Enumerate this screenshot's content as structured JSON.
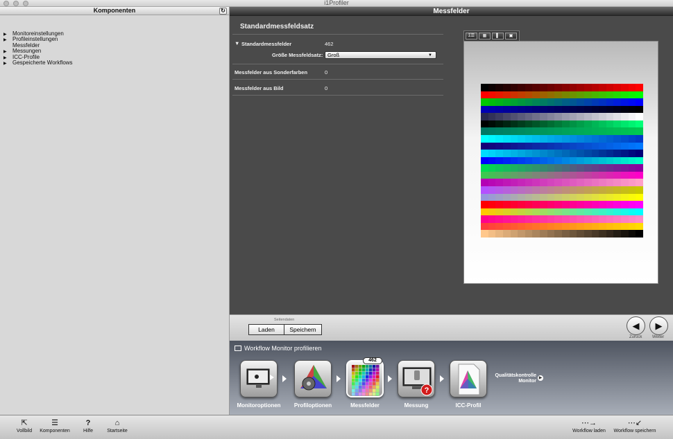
{
  "window": {
    "title": "i1Profiler"
  },
  "left_panel": {
    "header": "Komponenten",
    "refresh_icon": "refresh-icon",
    "items": [
      {
        "label": "Monitoreinstellungen",
        "expanded": false
      },
      {
        "label": "Profileinstellungen",
        "expanded": false
      },
      {
        "label": "Messfelder",
        "expanded": null
      },
      {
        "label": "Messungen",
        "expanded": false
      },
      {
        "label": "ICC-Profile",
        "expanded": false
      },
      {
        "label": "Gespeicherte Workflows",
        "expanded": false
      }
    ]
  },
  "main": {
    "header": "Messfelder",
    "section_title": "Standardmessfeldsatz",
    "rows": {
      "standard": {
        "label": "Standardmessfelder",
        "value": "462"
      },
      "size": {
        "label": "Größe Messfeldsatz:",
        "value": "Groß"
      },
      "spot": {
        "label": "Messfelder aus Sonderfarben",
        "value": "0"
      },
      "image": {
        "label": "Messfelder aus Bild",
        "value": "0"
      }
    },
    "preview_toolbar": [
      "sigma-grid-icon",
      "grid-icon",
      "single-patch-icon",
      "image-icon"
    ],
    "patch_grid": {
      "columns": 22,
      "rows": 21
    }
  },
  "nav": {
    "group_label": "Seitendaten",
    "load": "Laden",
    "save": "Speichern",
    "back": "Zurück",
    "next": "Weiter"
  },
  "workflow": {
    "title": "Workflow Monitor profilieren",
    "badge": "462",
    "steps": [
      {
        "label": "Monitoroptionen",
        "icon": "monitor-options-icon"
      },
      {
        "label": "Profiloptionen",
        "icon": "profile-options-icon"
      },
      {
        "label": "Messfelder",
        "icon": "patches-icon"
      },
      {
        "label": "Messung",
        "icon": "measurement-icon"
      },
      {
        "label": "ICC-Profil",
        "icon": "icc-profile-icon"
      }
    ],
    "quality_line1": "Qualitätskontrolle",
    "quality_line2": "Monitor"
  },
  "toolbar": {
    "fullscreen": "Vollbild",
    "components": "Komponenten",
    "help": "Hilfe",
    "home": "Startseite",
    "load_workflow": "Workflow laden",
    "save_workflow": "Workflow speichern"
  },
  "colors": {
    "accent": "#4a4a4a",
    "workflow_bg": "#6d7380",
    "error_badge": "#d21b1b"
  }
}
